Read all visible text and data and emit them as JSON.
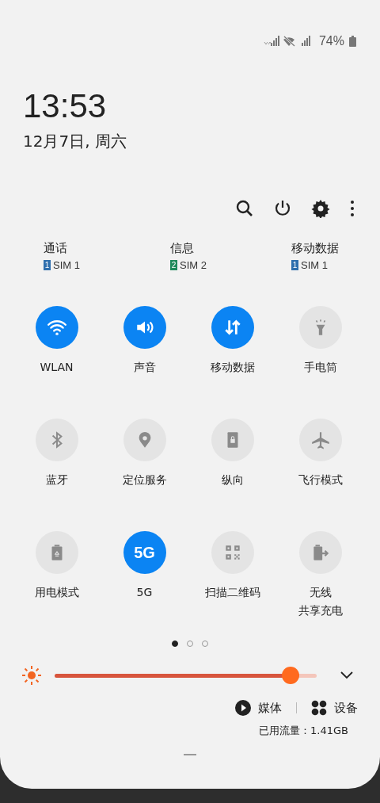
{
  "status_bar": {
    "battery": "74%"
  },
  "clock": {
    "time": "13:53",
    "date": "12月7日, 周六"
  },
  "sim_defaults": [
    {
      "label": "通话",
      "sim_number": "1",
      "sim": "SIM 1",
      "color": "#2f6fad"
    },
    {
      "label": "信息",
      "sim_number": "2",
      "sim": "SIM 2",
      "color": "#1f8a5a"
    },
    {
      "label": "移动数据",
      "sim_number": "1",
      "sim": "SIM 1",
      "color": "#2f6fad"
    }
  ],
  "tiles": [
    {
      "label": "WLAN",
      "on": true
    },
    {
      "label": "声音",
      "on": true
    },
    {
      "label": "移动数据",
      "on": true
    },
    {
      "label": "手电筒",
      "on": false
    },
    {
      "label": "蓝牙",
      "on": false
    },
    {
      "label": "定位服务",
      "on": false
    },
    {
      "label": "纵向",
      "on": false
    },
    {
      "label": "飞行模式",
      "on": false
    },
    {
      "label": "用电模式",
      "on": false
    },
    {
      "label": "5G",
      "on": true,
      "glyph": "5G"
    },
    {
      "label": "扫描二维码",
      "on": false
    },
    {
      "lines": [
        "无线",
        "共享充电"
      ],
      "on": false
    }
  ],
  "pages": [
    {
      "selected": true
    },
    {
      "selected": false
    },
    {
      "selected": false
    }
  ],
  "brightness": {
    "level": 0.9
  },
  "media_button": "媒体",
  "devices_button": "设备",
  "data_usage": "已用流量：1.41GB"
}
